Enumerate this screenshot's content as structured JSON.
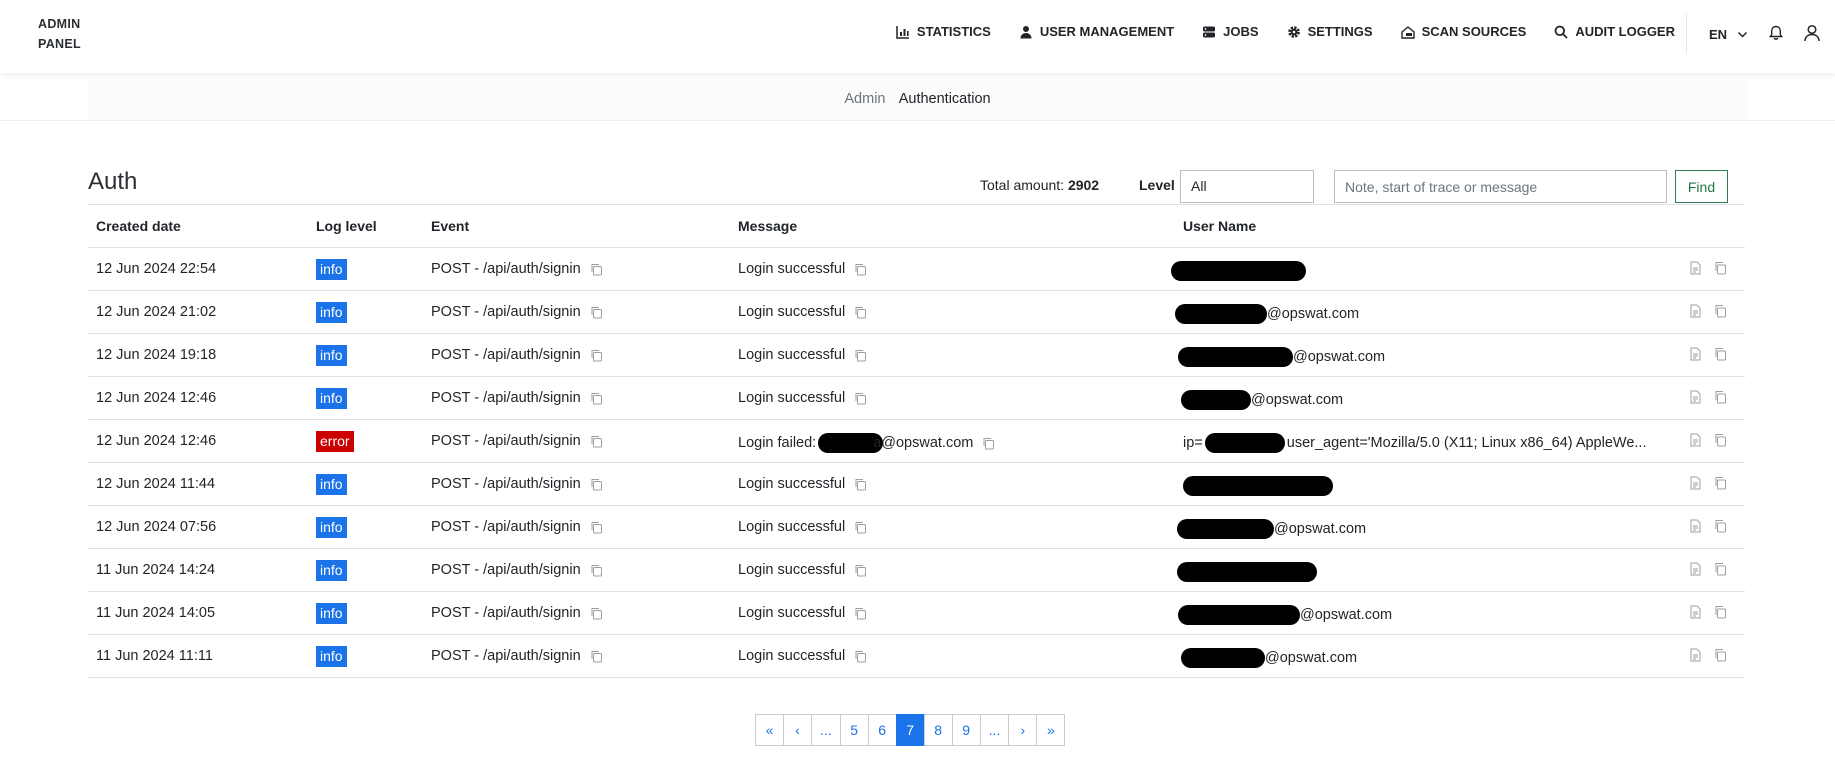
{
  "brand": {
    "line1": "ADMIN",
    "line2": "PANEL"
  },
  "nav": [
    {
      "label": "STATISTICS",
      "icon": "bar-chart-icon"
    },
    {
      "label": "USER MANAGEMENT",
      "icon": "user-icon"
    },
    {
      "label": "JOBS",
      "icon": "server-icon"
    },
    {
      "label": "SETTINGS",
      "icon": "gear-icon"
    },
    {
      "label": "SCAN SOURCES",
      "icon": "scan-source-icon"
    },
    {
      "label": "AUDIT LOGGER",
      "icon": "search-icon"
    }
  ],
  "language": "EN",
  "breadcrumb": {
    "parent": "Admin",
    "current": "Authentication"
  },
  "page_title": "Auth",
  "total": {
    "label": "Total amount:",
    "value": "2902"
  },
  "level": {
    "label": "Level",
    "value": "All"
  },
  "search": {
    "placeholder": "Note, start of trace or message",
    "value": ""
  },
  "find_label": "Find",
  "columns": [
    "Created date",
    "Log level",
    "Event",
    "Message",
    "User Name"
  ],
  "rows": [
    {
      "date": "12 Jun 2024 22:54",
      "level": "info",
      "event": "POST - /api/auth/signin",
      "message": "Login successful",
      "user_suffix": ""
    },
    {
      "date": "12 Jun 2024 21:02",
      "level": "info",
      "event": "POST - /api/auth/signin",
      "message": "Login successful",
      "user_suffix": "@opswat.com"
    },
    {
      "date": "12 Jun 2024 19:18",
      "level": "info",
      "event": "POST - /api/auth/signin",
      "message": "Login successful",
      "user_suffix": "@opswat.com"
    },
    {
      "date": "12 Jun 2024 12:46",
      "level": "info",
      "event": "POST - /api/auth/signin",
      "message": "Login successful",
      "user_suffix": "@opswat.com"
    },
    {
      "date": "12 Jun 2024 12:46",
      "level": "error",
      "event": "POST - /api/auth/signin",
      "message": "Login failed:",
      "message_suffix": "a@opswat.com",
      "user_prefix": "ip=",
      "user_suffix": "user_agent='Mozilla/5.0 (X11; Linux x86_64) AppleWe..."
    },
    {
      "date": "12 Jun 2024 11:44",
      "level": "info",
      "event": "POST - /api/auth/signin",
      "message": "Login successful",
      "user_suffix": ""
    },
    {
      "date": "12 Jun 2024 07:56",
      "level": "info",
      "event": "POST - /api/auth/signin",
      "message": "Login successful",
      "user_suffix": "@opswat.com"
    },
    {
      "date": "11 Jun 2024 14:24",
      "level": "info",
      "event": "POST - /api/auth/signin",
      "message": "Login successful",
      "user_suffix": ""
    },
    {
      "date": "11 Jun 2024 14:05",
      "level": "info",
      "event": "POST - /api/auth/signin",
      "message": "Login successful",
      "user_suffix": "@opswat.com"
    },
    {
      "date": "11 Jun 2024 11:11",
      "level": "info",
      "event": "POST - /api/auth/signin",
      "message": "Login successful",
      "user_suffix": "@opswat.com"
    }
  ],
  "pagination": [
    "«",
    "‹",
    "...",
    "5",
    "6",
    "7",
    "8",
    "9",
    "...",
    "›",
    "»"
  ],
  "current_page": "7",
  "colors": {
    "accent": "#1a73e8",
    "error": "#cc0000",
    "find": "#1f7a45"
  }
}
